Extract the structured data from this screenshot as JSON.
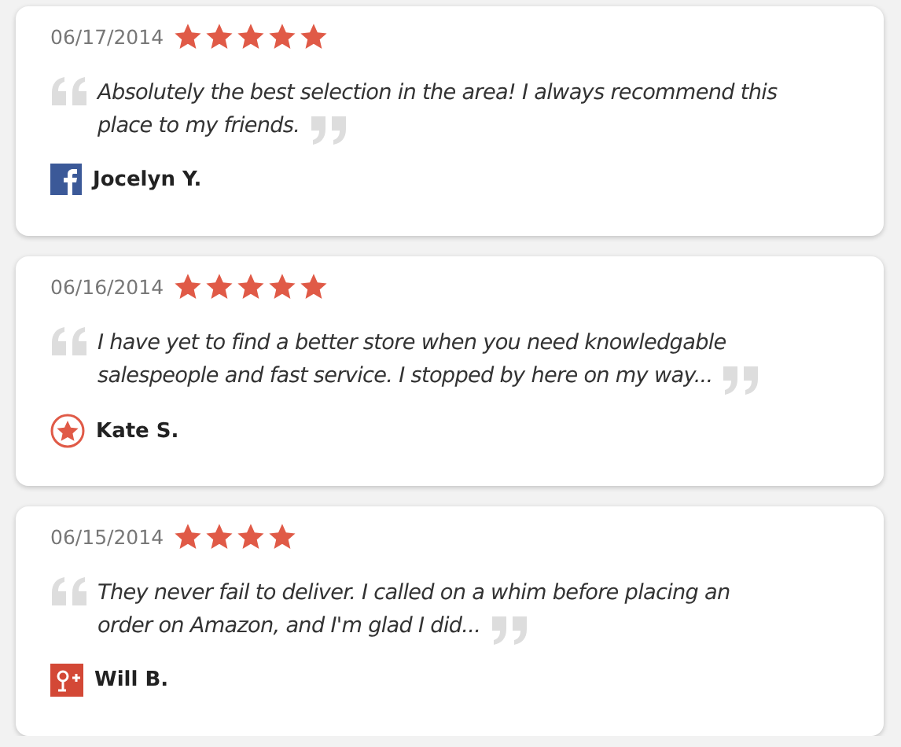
{
  "reviews": [
    {
      "date": "06/17/2014",
      "stars": 5,
      "text": "Absolutely the best selection in the area! I always recommend this place to my friends.",
      "author": "Jocelyn Y.",
      "source": {
        "kind": "facebook"
      }
    },
    {
      "date": "06/16/2014",
      "stars": 5,
      "text": "I have yet to find a better store when you need knowledgable salespeople and fast service. I stopped by here on my way...",
      "author": "Kate S.",
      "source": {
        "kind": "star"
      }
    },
    {
      "date": "06/15/2014",
      "stars": 4,
      "text": "They never fail to deliver. I called on a whim before placing an order on Amazon, and I'm glad I did...",
      "author": "Will B.",
      "source": {
        "kind": "google"
      }
    }
  ]
}
